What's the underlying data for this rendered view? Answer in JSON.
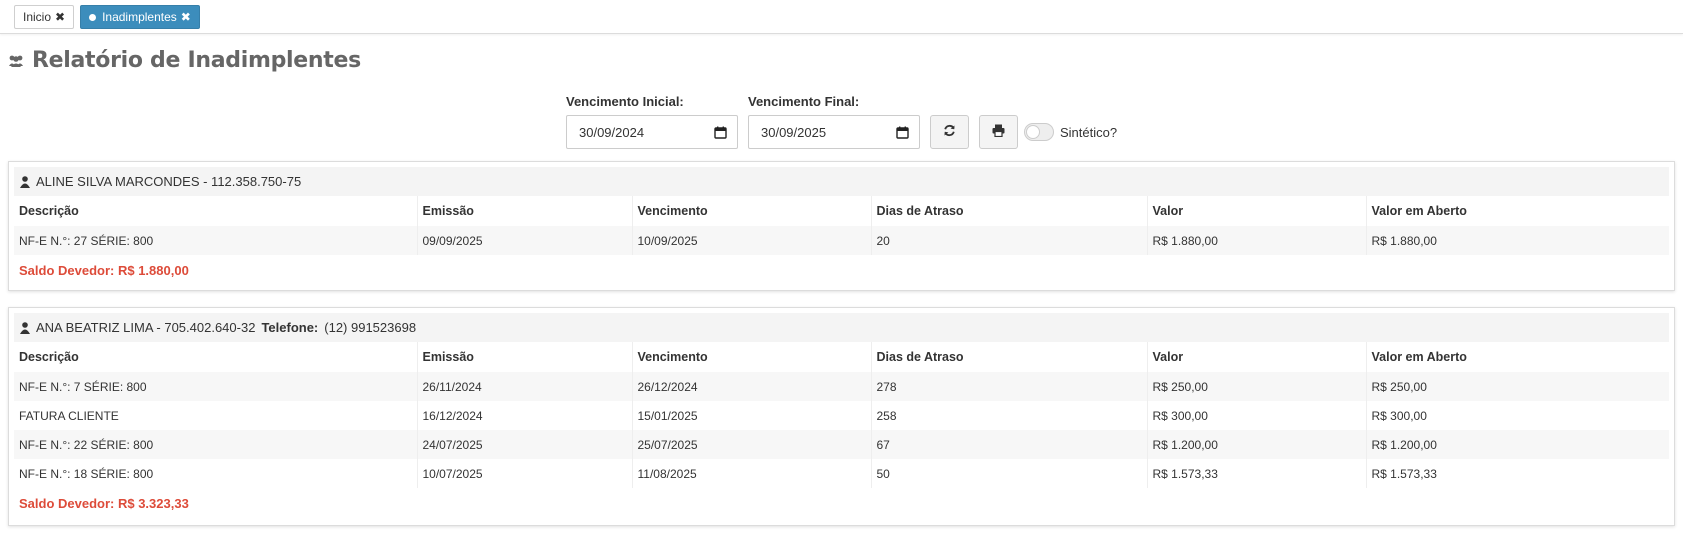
{
  "tabs": [
    {
      "label": "Inicio",
      "active": false
    },
    {
      "label": "Inadimplentes",
      "active": true
    }
  ],
  "page": {
    "title": "Relatório de Inadimplentes",
    "icon": "users-icon"
  },
  "filters": {
    "start_label": "Vencimento Inicial:",
    "start_value": "30/09/2024",
    "end_label": "Vencimento Final:",
    "end_value": "30/09/2025",
    "refresh_icon": "refresh-icon",
    "print_icon": "print-icon",
    "synthetic_label": "Sintético?",
    "synthetic_on": false
  },
  "columns": [
    "Descrição",
    "Emissão",
    "Vencimento",
    "Dias de Atraso",
    "Valor",
    "Valor em Aberto"
  ],
  "clients": [
    {
      "name": "ALINE SILVA MARCONDES - 112.358.750-75",
      "phone_label": "",
      "phone": "",
      "rows": [
        [
          "NF-E N.°: 27 SÉRIE: 800",
          "09/09/2025",
          "10/09/2025",
          "20",
          "R$ 1.880,00",
          "R$ 1.880,00"
        ]
      ],
      "saldo": "Saldo Devedor: R$ 1.880,00"
    },
    {
      "name": "ANA BEATRIZ LIMA - 705.402.640-32",
      "phone_label": "Telefone:",
      "phone": "(12) 991523698",
      "rows": [
        [
          "NF-E N.°: 7 SÉRIE: 800",
          "26/11/2024",
          "26/12/2024",
          "278",
          "R$ 250,00",
          "R$ 250,00"
        ],
        [
          "FATURA CLIENTE",
          "16/12/2024",
          "15/01/2025",
          "258",
          "R$ 300,00",
          "R$ 300,00"
        ],
        [
          "NF-E N.°: 22 SÉRIE: 800",
          "24/07/2025",
          "25/07/2025",
          "67",
          "R$ 1.200,00",
          "R$ 1.200,00"
        ],
        [
          "NF-E N.°: 18 SÉRIE: 800",
          "10/07/2025",
          "11/08/2025",
          "50",
          "R$ 1.573,33",
          "R$ 1.573,33"
        ]
      ],
      "saldo": "Saldo Devedor: R$ 3.323,33"
    }
  ],
  "colors": {
    "accent": "#3c8dbc",
    "danger": "#dd4b39",
    "title": "#666666"
  }
}
